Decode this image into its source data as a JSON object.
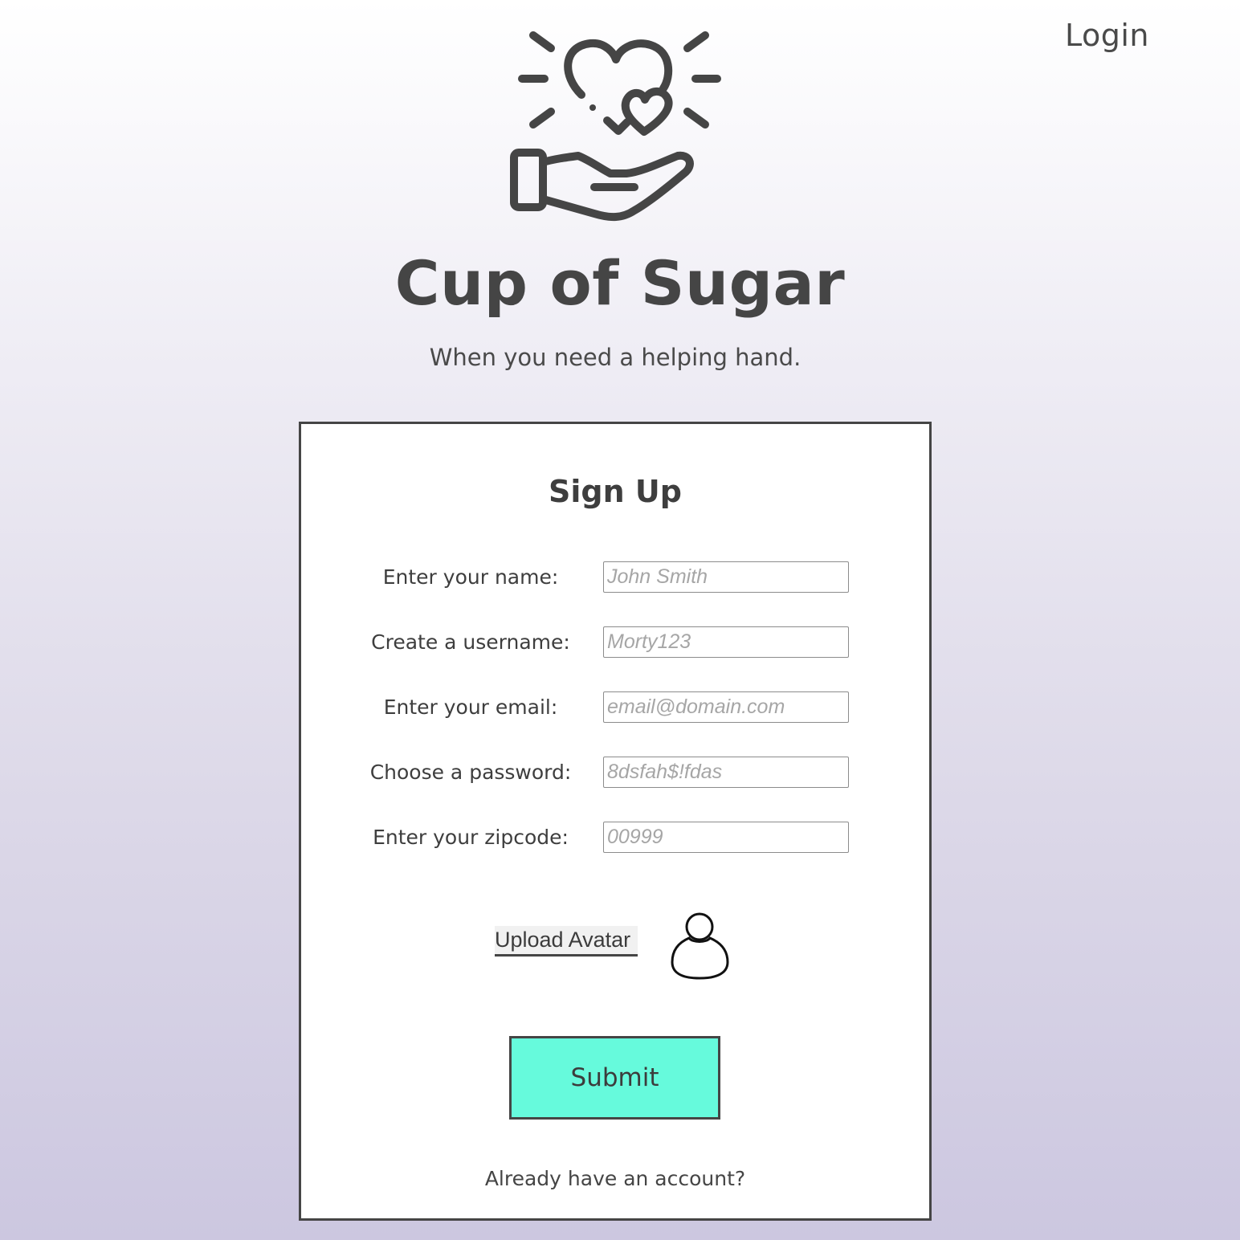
{
  "header": {
    "login_label": "Login"
  },
  "brand": {
    "logo_icon": "hand-holding-hearts-icon",
    "title": "Cup of Sugar",
    "tagline": "When you need a helping hand."
  },
  "signup": {
    "title": "Sign Up",
    "fields": [
      {
        "label": "Enter your name:",
        "placeholder": "John Smith",
        "value": ""
      },
      {
        "label": "Create a username:",
        "placeholder": "Morty123",
        "value": ""
      },
      {
        "label": "Enter your email:",
        "placeholder": "email@domain.com",
        "value": ""
      },
      {
        "label": "Choose a password:",
        "placeholder": "8dsfah$!fdas",
        "value": ""
      },
      {
        "label": "Enter your zipcode:",
        "placeholder": "00999",
        "value": ""
      }
    ],
    "upload_label": "Upload Avatar",
    "avatar_icon": "user-icon",
    "submit_label": "Submit",
    "account_link": "Already have an account?"
  },
  "colors": {
    "submit_bg": "#66fadc",
    "text": "#454545",
    "background_top": "#ffffff",
    "background_bottom": "#ccc7e0"
  }
}
